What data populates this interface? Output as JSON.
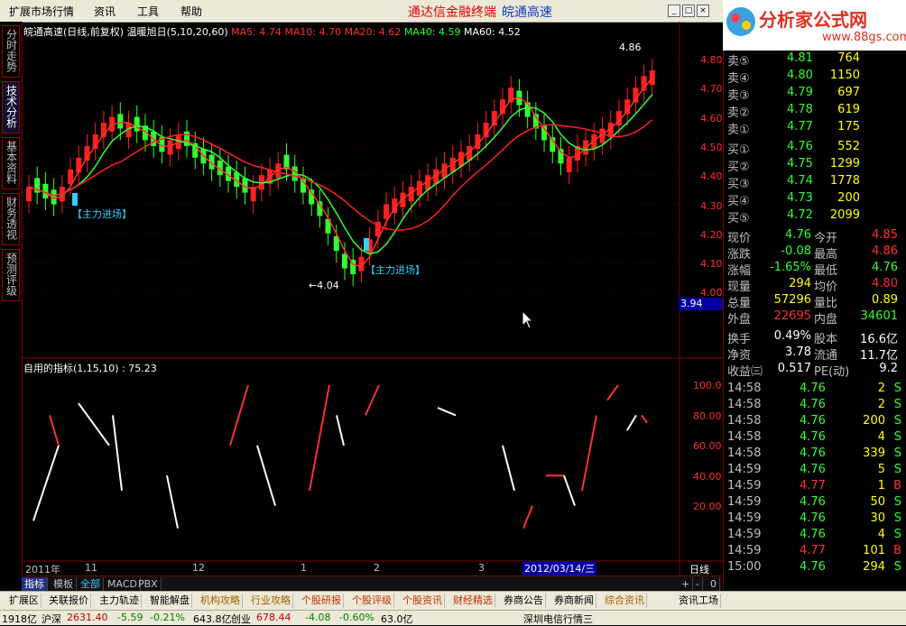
{
  "menubar": {
    "items": [
      "扩展市场行情",
      "资讯",
      "工具",
      "帮助"
    ],
    "headline_red": "通达信金融终端",
    "headline_blue": "皖通高速",
    "logo_text": "分析家公式网",
    "logo_url_text": "www.88gs.com"
  },
  "sidetabs": [
    "分时走势",
    "技术分析",
    "基本资料",
    "财务透视",
    "预测评级"
  ],
  "main_header": {
    "title": "皖通高速(日线,前复权)",
    "indicator": "温暖旭日(5,10,20,60)",
    "ma5": "MA5: 4.74",
    "ma10": "MA10: 4.70",
    "ma20": "MA20: 4.62",
    "ma40": "MA40: 4.59",
    "ma60": "MA60: 4.52",
    "max_label": "4.86",
    "min_label": "←4.04",
    "signal1": "【主力进场】",
    "signal2": "【主力进场】",
    "cursor_price": "3.94"
  },
  "price_axis": [
    "4.80",
    "4.70",
    "4.60",
    "4.50",
    "4.40",
    "4.30",
    "4.20",
    "4.10",
    "4.00"
  ],
  "sub_header": {
    "title": "自用的指标(1,15,10)",
    "value": ": 75.23"
  },
  "sub_axis": [
    "100.0",
    "80.00",
    "60.00",
    "40.00",
    "20.00"
  ],
  "date_axis": {
    "labels": [
      "2011年",
      "11",
      "12",
      "1",
      "2",
      "3"
    ],
    "cursor_date": "2012/03/14/三",
    "period": "日线"
  },
  "bottom_tabs": [
    "指标",
    "模板",
    "全部",
    "MACD",
    "PBX"
  ],
  "bottom_ctrls": [
    "+",
    "-",
    "0"
  ],
  "func_buttons": [
    "扩展区",
    "关联报价",
    "主力轨迹",
    "智能解盘",
    "机构攻略",
    "行业攻略",
    "个股研报",
    "个股评级",
    "个股资讯",
    "财经精选",
    "券商公告",
    "券商新闻",
    "综合资讯"
  ],
  "func_right": "资讯工场",
  "order_book": {
    "asks": [
      {
        "label": "卖⑤",
        "price": "4.81",
        "vol": "764"
      },
      {
        "label": "卖④",
        "price": "4.80",
        "vol": "1150"
      },
      {
        "label": "卖③",
        "price": "4.79",
        "vol": "697"
      },
      {
        "label": "卖②",
        "price": "4.78",
        "vol": "619"
      },
      {
        "label": "卖①",
        "price": "4.77",
        "vol": "175"
      }
    ],
    "bids": [
      {
        "label": "买①",
        "price": "4.76",
        "vol": "552"
      },
      {
        "label": "买②",
        "price": "4.75",
        "vol": "1299"
      },
      {
        "label": "买③",
        "price": "4.74",
        "vol": "1778"
      },
      {
        "label": "买④",
        "price": "4.73",
        "vol": "200"
      },
      {
        "label": "买⑤",
        "price": "4.72",
        "vol": "2099"
      }
    ]
  },
  "quote": [
    {
      "l1": "现价",
      "v1": "4.76",
      "c1": "#30ff30",
      "l2": "今开",
      "v2": "4.85",
      "c2": "#ff3030"
    },
    {
      "l1": "涨跌",
      "v1": "-0.08",
      "c1": "#30ff30",
      "l2": "最高",
      "v2": "4.86",
      "c2": "#ff3030"
    },
    {
      "l1": "涨幅",
      "v1": "-1.65%",
      "c1": "#30ff30",
      "l2": "最低",
      "v2": "4.76",
      "c2": "#30ff30"
    },
    {
      "l1": "现量",
      "v1": "294",
      "c1": "#ffff00",
      "l2": "均价",
      "v2": "4.80",
      "c2": "#ff3030"
    },
    {
      "l1": "总量",
      "v1": "57296",
      "c1": "#ffff00",
      "l2": "量比",
      "v2": "0.89",
      "c2": "#ffff00"
    },
    {
      "l1": "外盘",
      "v1": "22695",
      "c1": "#ff3030",
      "l2": "内盘",
      "v2": "34601",
      "c2": "#30ff30"
    }
  ],
  "fundamentals": [
    {
      "l1": "换手",
      "v1": "0.49%",
      "l2": "股本",
      "v2": "16.6亿"
    },
    {
      "l1": "净资",
      "v1": "3.78",
      "l2": "流通",
      "v2": "11.7亿"
    },
    {
      "l1": "收益㈢",
      "v1": "0.517",
      "l2": "PE(动)",
      "v2": "9.2"
    }
  ],
  "ticks": [
    {
      "t": "14:58",
      "p": "4.76",
      "v": "2",
      "d": "S"
    },
    {
      "t": "14:58",
      "p": "4.76",
      "v": "2",
      "d": "S"
    },
    {
      "t": "14:58",
      "p": "4.76",
      "v": "200",
      "d": "S"
    },
    {
      "t": "14:58",
      "p": "4.76",
      "v": "4",
      "d": "S"
    },
    {
      "t": "14:58",
      "p": "4.76",
      "v": "339",
      "d": "S"
    },
    {
      "t": "14:59",
      "p": "4.76",
      "v": "5",
      "d": "S"
    },
    {
      "t": "14:59",
      "p": "4.77",
      "v": "1",
      "d": "B"
    },
    {
      "t": "14:59",
      "p": "4.76",
      "v": "50",
      "d": "S"
    },
    {
      "t": "14:59",
      "p": "4.76",
      "v": "30",
      "d": "S"
    },
    {
      "t": "14:59",
      "p": "4.76",
      "v": "4",
      "d": "S"
    },
    {
      "t": "14:59",
      "p": "4.77",
      "v": "101",
      "d": "B"
    },
    {
      "t": "15:00",
      "p": "4.76",
      "v": "294",
      "d": "S"
    }
  ],
  "right_tabs": [
    "笔",
    "价",
    "细",
    "盘",
    "势",
    "指",
    "值",
    "资"
  ],
  "statusbar": {
    "a": "1918亿",
    "b": "沪深",
    "c": "2631.40",
    "d": "-5.59",
    "e": "-0.21%",
    "f": "643.8亿",
    "g": "创业",
    "h": "678.44",
    "i": "-4.08",
    "j": "-0.60%",
    "k": "63.0亿",
    "l": "深圳电信行情三"
  }
}
